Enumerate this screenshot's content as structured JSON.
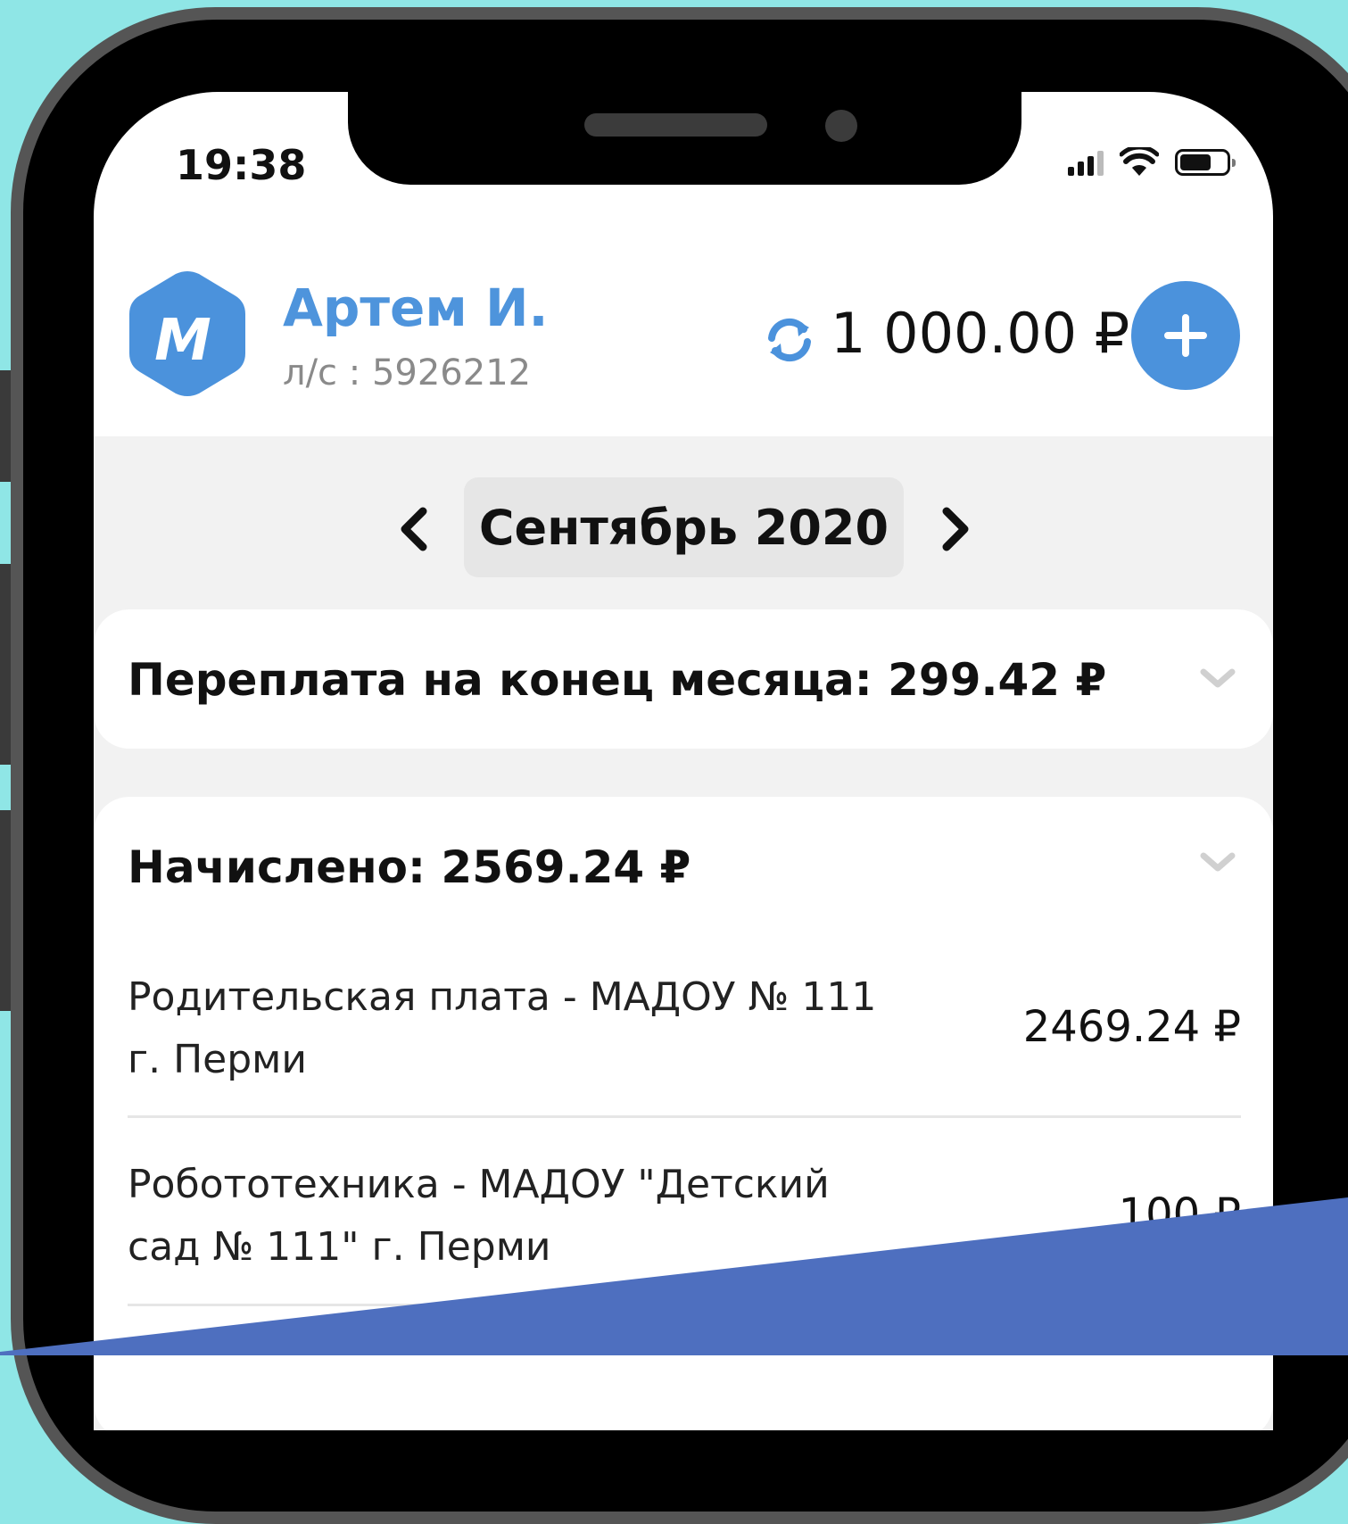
{
  "status_bar": {
    "time": "19:38"
  },
  "header": {
    "user_name": "Артем И.",
    "account_label": "л/с : 5926212",
    "avatar_letter": "M",
    "balance": "1 000.00 ₽",
    "brand_color": "#4b92dc"
  },
  "month_selector": {
    "current": "Сентябрь 2020"
  },
  "overpayment": {
    "title": "Переплата на конец месяца: 299.42 ₽"
  },
  "charges": {
    "title": "Начислено: 2569.24 ₽",
    "rows": [
      {
        "label_line1": "Родительская плата - МАДОУ № 111",
        "label_line2": "г. Перми",
        "amount": "2469.24 ₽"
      },
      {
        "label_line1": "Робототехника - МАДОУ \"Детский",
        "label_line2": "сад № 111\" г. Перми",
        "amount": "100 ₽"
      }
    ]
  },
  "colors": {
    "background": "#8fe6e6",
    "accent_band": "#4e6fbf"
  }
}
